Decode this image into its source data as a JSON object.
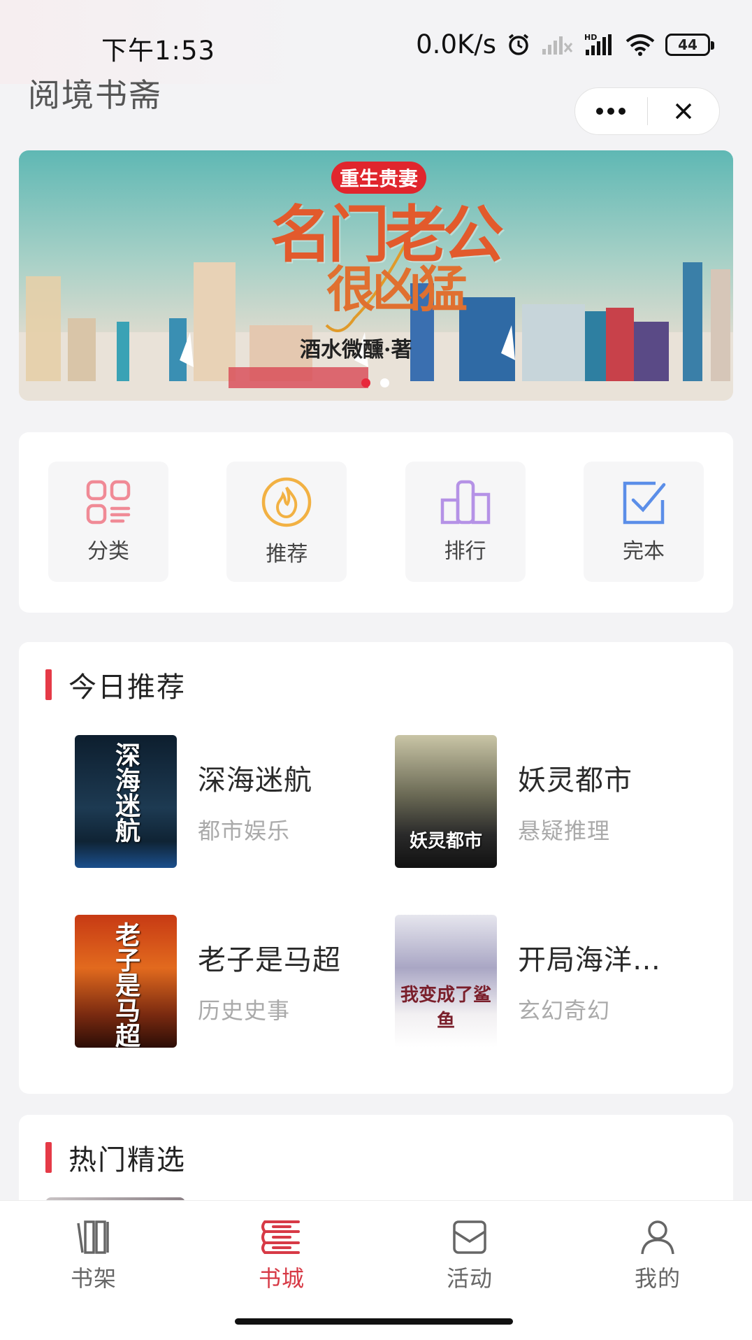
{
  "status_bar": {
    "time": "下午1:53",
    "net_speed": "0.0K/s",
    "battery": "44",
    "network_badge": "HD"
  },
  "app": {
    "title": "阅境书斋"
  },
  "banner": {
    "tag": "重生贵妻",
    "title_line1": "名门老公",
    "title_line2": "很凶猛",
    "author": "酒水微醺·著",
    "slides": 2,
    "active_slide": 1
  },
  "quick_menu": [
    {
      "label": "分类",
      "icon": "category-icon",
      "color": "#f08a96"
    },
    {
      "label": "推荐",
      "icon": "flame-icon",
      "color": "#f2b143"
    },
    {
      "label": "排行",
      "icon": "ranking-icon",
      "color": "#b592e6"
    },
    {
      "label": "完本",
      "icon": "checkbox-icon",
      "color": "#5b8ee8"
    }
  ],
  "today_recommend": {
    "title": "今日推荐",
    "books": [
      {
        "title": "深海迷航",
        "genre": "都市娱乐",
        "cover_text": "深海迷航"
      },
      {
        "title": "妖灵都市",
        "genre": "悬疑推理",
        "cover_text": "妖灵都市"
      },
      {
        "title": "老子是马超",
        "genre": "历史史事",
        "cover_text": "老子是马超"
      },
      {
        "title": "开局海洋…",
        "genre": "玄幻奇幻",
        "cover_text": "我变成了鲨鱼"
      }
    ]
  },
  "hot_picks": {
    "title": "热门精选"
  },
  "tab_bar": [
    {
      "label": "书架",
      "icon": "bookshelf-icon"
    },
    {
      "label": "书城",
      "icon": "bookstore-icon",
      "active": true
    },
    {
      "label": "活动",
      "icon": "activity-icon"
    },
    {
      "label": "我的",
      "icon": "profile-icon"
    }
  ],
  "colors": {
    "accent": "#d73a46",
    "section_bar": "#e53a47"
  }
}
